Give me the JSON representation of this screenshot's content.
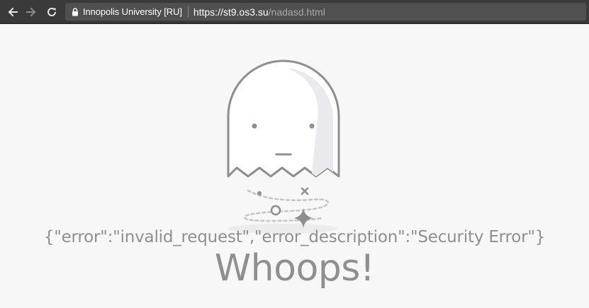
{
  "browser": {
    "site_identity": "Innopolis University [RU]",
    "url_host": "https://st9.os3.su",
    "url_path": "/nadasd.html",
    "icons": {
      "back": "arrow-left-icon",
      "forward": "arrow-right-icon",
      "reload": "reload-icon",
      "security": "lock-icon"
    }
  },
  "page": {
    "illustration": "ghost-illustration",
    "error_json": "{\"error\":\"invalid_request\",\"error_description\":\"Security Error\"}",
    "heading": "Whoops!"
  }
}
